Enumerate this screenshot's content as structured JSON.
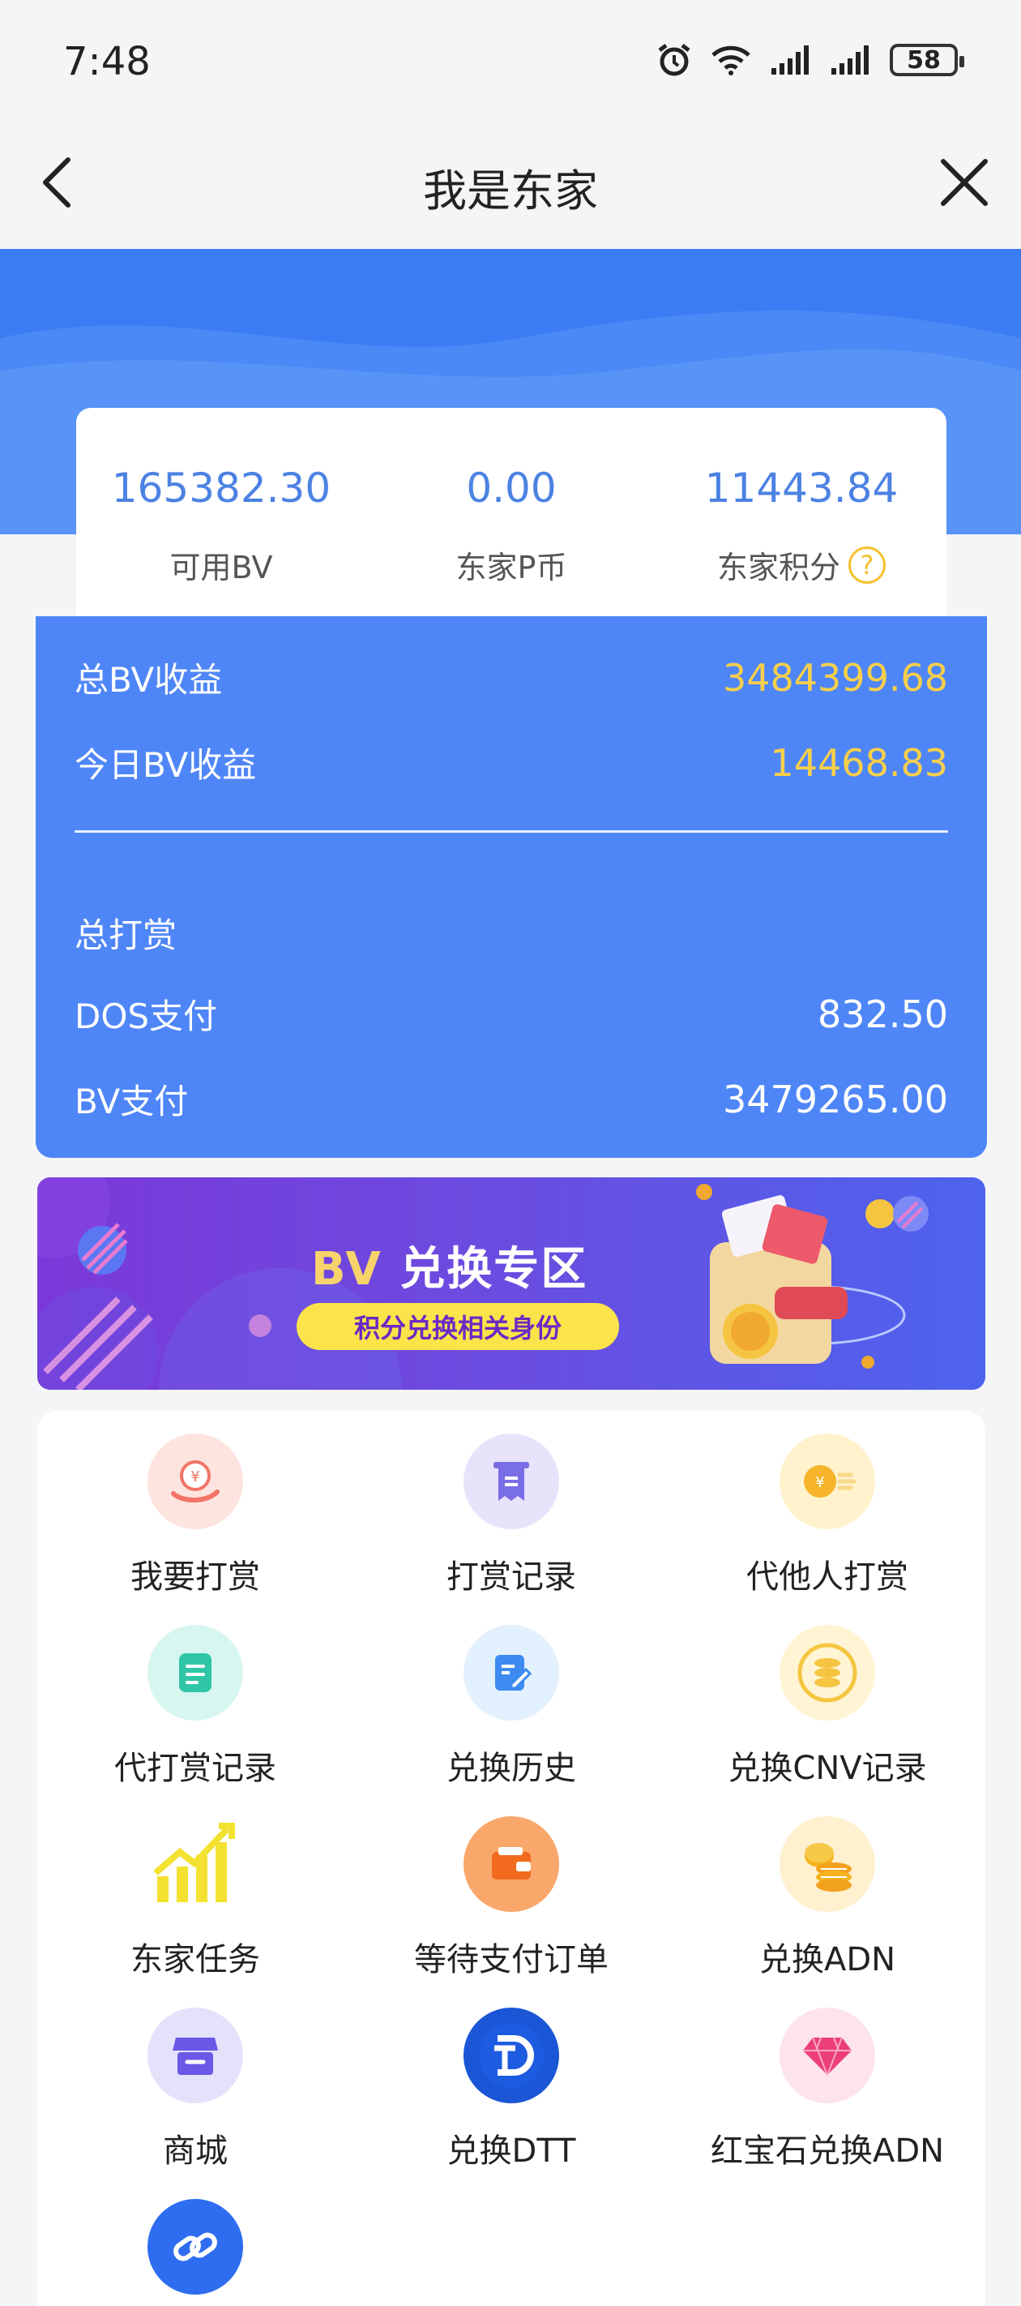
{
  "status_bar": {
    "time": "7:48",
    "battery": "58"
  },
  "header": {
    "title": "我是东家"
  },
  "stats": [
    {
      "value": "165382.30",
      "label": "可用BV"
    },
    {
      "value": "0.00",
      "label": "东家P币"
    },
    {
      "value": "11443.84",
      "label": "东家积分"
    }
  ],
  "earnings": {
    "total_bv_label": "总BV收益",
    "total_bv_value": "3484399.68",
    "today_bv_label": "今日BV收益",
    "today_bv_value": "14468.83",
    "tip_total_label": "总打赏",
    "dos_label": "DOS支付",
    "dos_value": "832.50",
    "bv_pay_label": "BV支付",
    "bv_pay_value": "3479265.00"
  },
  "banner": {
    "title_prefix": "BV",
    "title_rest": " 兑换专区",
    "pill": "积分兑换相关身份"
  },
  "grid": [
    {
      "label": "我要打赏",
      "icon": "reward-hand-icon"
    },
    {
      "label": "打赏记录",
      "icon": "receipt-icon"
    },
    {
      "label": "代他人打赏",
      "icon": "coin-icon"
    },
    {
      "label": "代打赏记录",
      "icon": "document-icon"
    },
    {
      "label": "兑换历史",
      "icon": "edit-note-icon"
    },
    {
      "label": "兑换CNV记录",
      "icon": "coin-stack-icon"
    },
    {
      "label": "东家任务",
      "icon": "growth-chart-icon"
    },
    {
      "label": "等待支付订单",
      "icon": "wallet-icon"
    },
    {
      "label": "兑换ADN",
      "icon": "gold-coins-icon"
    },
    {
      "label": "商城",
      "icon": "store-icon"
    },
    {
      "label": "兑换DTT",
      "icon": "dtt-logo-icon"
    },
    {
      "label": "红宝石兑换ADN",
      "icon": "ruby-icon"
    },
    {
      "label": "",
      "icon": "link-icon"
    }
  ]
}
